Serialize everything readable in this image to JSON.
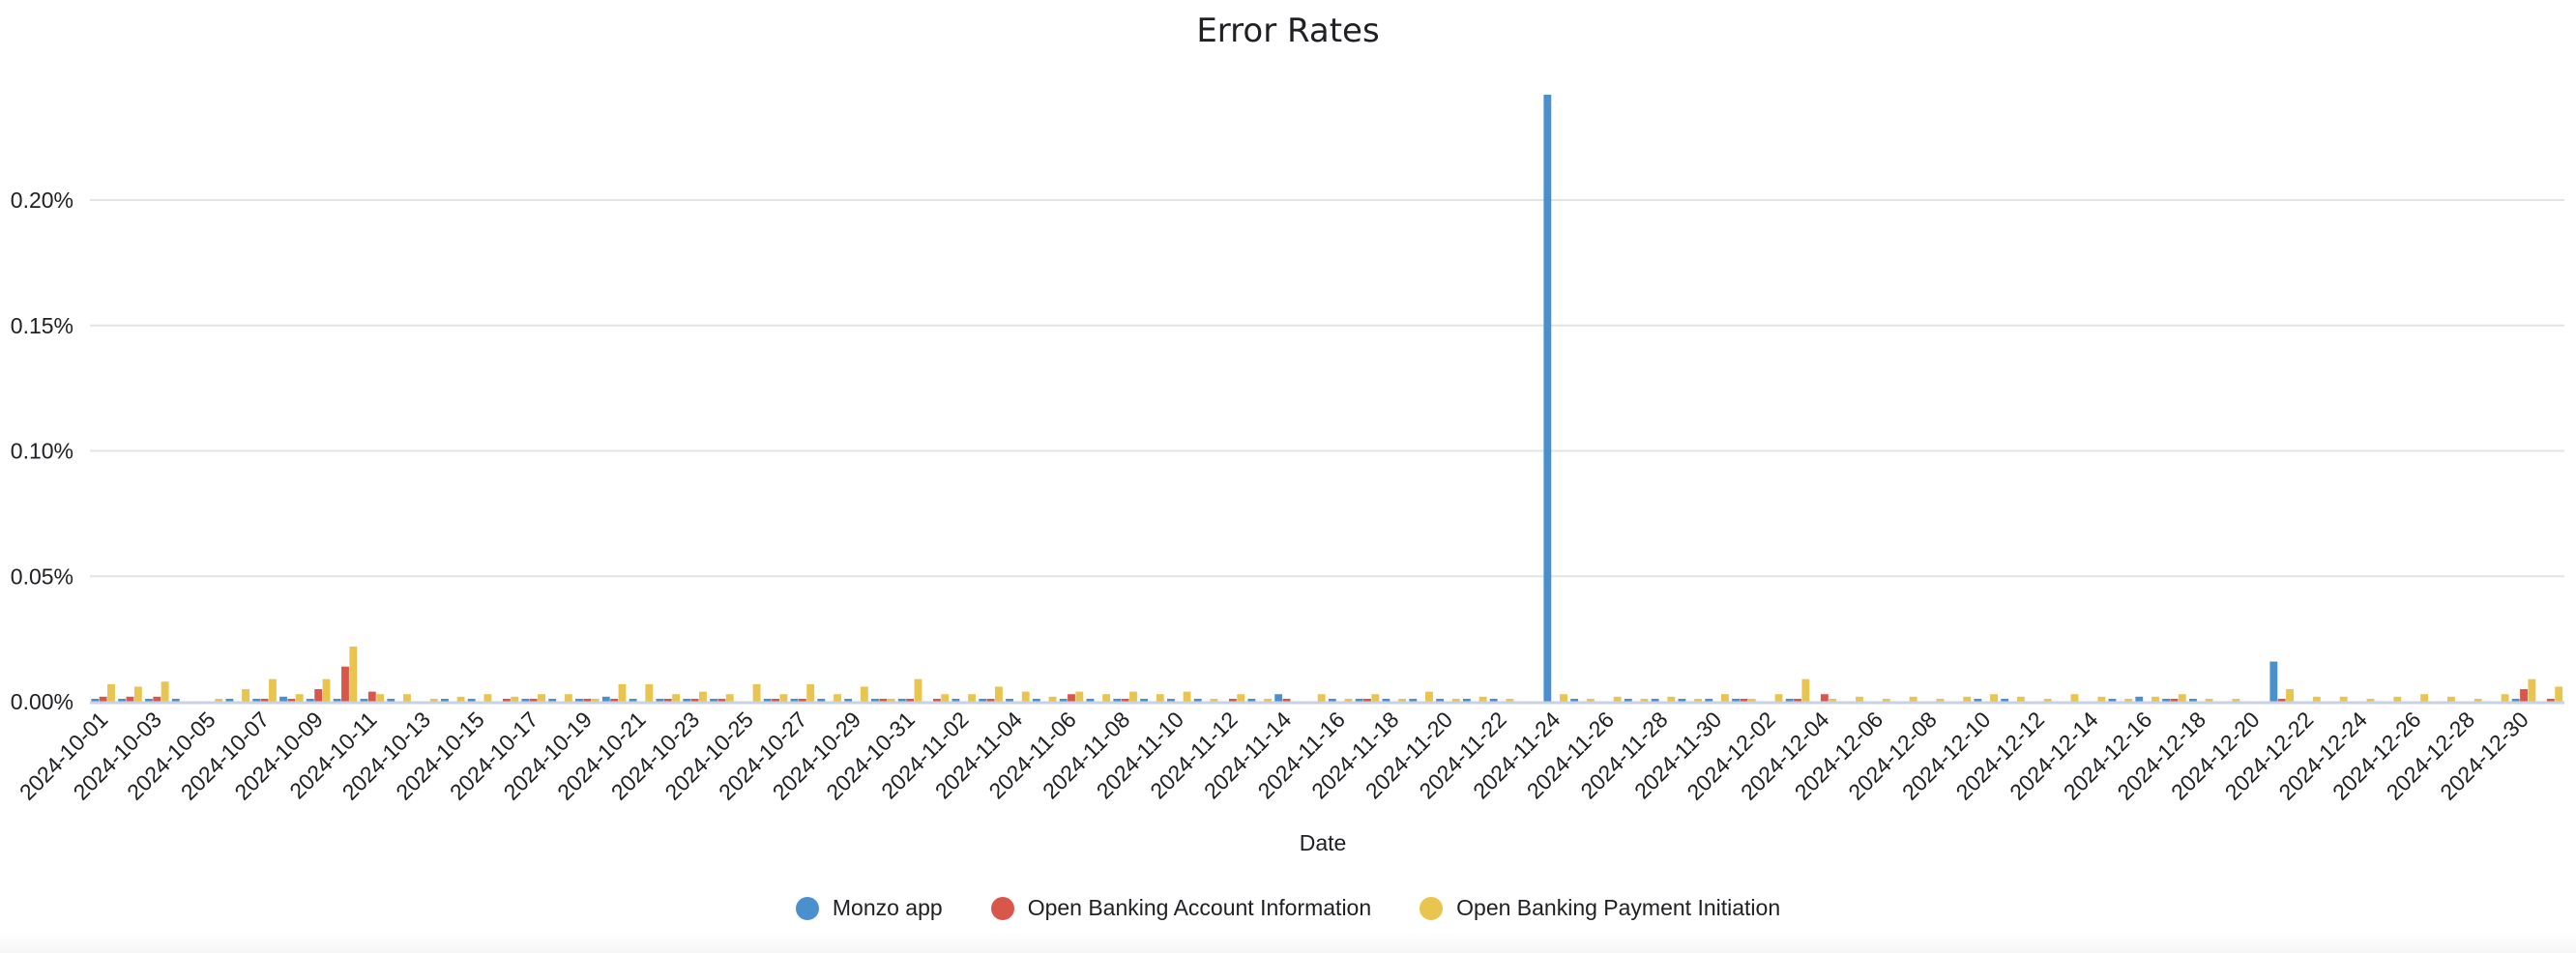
{
  "chart_data": {
    "type": "bar",
    "title": "Error Rates",
    "xlabel": "Date",
    "ylabel": "",
    "ylim": [
      0,
      0.25
    ],
    "yticks": [
      0,
      0.05,
      0.1,
      0.15,
      0.2
    ],
    "ytick_labels": [
      "0.00%",
      "0.05%",
      "0.10%",
      "0.15%",
      "0.20%"
    ],
    "grid": true,
    "legend_position": "bottom",
    "start_date": "2024-10-01",
    "end_date": "2024-12-31",
    "categories": [
      "2024-10-01",
      "2024-10-02",
      "2024-10-03",
      "2024-10-04",
      "2024-10-05",
      "2024-10-06",
      "2024-10-07",
      "2024-10-08",
      "2024-10-09",
      "2024-10-10",
      "2024-10-11",
      "2024-10-12",
      "2024-10-13",
      "2024-10-14",
      "2024-10-15",
      "2024-10-16",
      "2024-10-17",
      "2024-10-18",
      "2024-10-19",
      "2024-10-20",
      "2024-10-21",
      "2024-10-22",
      "2024-10-23",
      "2024-10-24",
      "2024-10-25",
      "2024-10-26",
      "2024-10-27",
      "2024-10-28",
      "2024-10-29",
      "2024-10-30",
      "2024-10-31",
      "2024-11-01",
      "2024-11-02",
      "2024-11-03",
      "2024-11-04",
      "2024-11-05",
      "2024-11-06",
      "2024-11-07",
      "2024-11-08",
      "2024-11-09",
      "2024-11-10",
      "2024-11-11",
      "2024-11-12",
      "2024-11-13",
      "2024-11-14",
      "2024-11-15",
      "2024-11-16",
      "2024-11-17",
      "2024-11-18",
      "2024-11-19",
      "2024-11-20",
      "2024-11-21",
      "2024-11-22",
      "2024-11-23",
      "2024-11-24",
      "2024-11-25",
      "2024-11-26",
      "2024-11-27",
      "2024-11-28",
      "2024-11-29",
      "2024-11-30",
      "2024-12-01",
      "2024-12-02",
      "2024-12-03",
      "2024-12-04",
      "2024-12-05",
      "2024-12-06",
      "2024-12-07",
      "2024-12-08",
      "2024-12-09",
      "2024-12-10",
      "2024-12-11",
      "2024-12-12",
      "2024-12-13",
      "2024-12-14",
      "2024-12-15",
      "2024-12-16",
      "2024-12-17",
      "2024-12-18",
      "2024-12-19",
      "2024-12-20",
      "2024-12-21",
      "2024-12-22",
      "2024-12-23",
      "2024-12-24",
      "2024-12-25",
      "2024-12-26",
      "2024-12-27",
      "2024-12-28",
      "2024-12-29",
      "2024-12-30",
      "2024-12-31"
    ],
    "tick_labels": [
      "2024-10-01",
      "2024-10-03",
      "2024-10-05",
      "2024-10-07",
      "2024-10-09",
      "2024-10-11",
      "2024-10-13",
      "2024-10-15",
      "2024-10-17",
      "2024-10-19",
      "2024-10-21",
      "2024-10-23",
      "2024-10-25",
      "2024-10-27",
      "2024-10-29",
      "2024-10-31",
      "2024-11-02",
      "2024-11-04",
      "2024-11-06",
      "2024-11-08",
      "2024-11-10",
      "2024-11-12",
      "2024-11-14",
      "2024-11-16",
      "2024-11-18",
      "2024-11-20",
      "2024-11-22",
      "2024-11-24",
      "2024-11-26",
      "2024-11-28",
      "2024-11-30",
      "2024-12-02",
      "2024-12-04",
      "2024-12-06",
      "2024-12-08",
      "2024-12-10",
      "2024-12-12",
      "2024-12-14",
      "2024-12-16",
      "2024-12-18",
      "2024-12-20",
      "2024-12-22",
      "2024-12-24",
      "2024-12-26",
      "2024-12-28",
      "2024-12-30"
    ],
    "series": [
      {
        "name": "Monzo app",
        "color": "#4a90cc",
        "values": [
          0.001,
          0.001,
          0.001,
          0.001,
          0,
          0.001,
          0.001,
          0.002,
          0.001,
          0.001,
          0.001,
          0.001,
          0,
          0.001,
          0.001,
          0,
          0.001,
          0.001,
          0.001,
          0.002,
          0.001,
          0.001,
          0.001,
          0.001,
          0,
          0.001,
          0.001,
          0.001,
          0.001,
          0.001,
          0.001,
          0,
          0.001,
          0.001,
          0.001,
          0.001,
          0.001,
          0.001,
          0.001,
          0.001,
          0.001,
          0.001,
          0,
          0.001,
          0.003,
          0,
          0.001,
          0.001,
          0.001,
          0.001,
          0.001,
          0.001,
          0.001,
          0,
          0.242,
          0.001,
          0,
          0.001,
          0.001,
          0.001,
          0.001,
          0.001,
          0,
          0.001,
          0,
          0,
          0,
          0,
          0,
          0,
          0.001,
          0.001,
          0,
          0,
          0,
          0.001,
          0.002,
          0.001,
          0.001,
          0,
          0,
          0.016,
          0,
          0,
          0,
          0,
          0,
          0,
          0,
          0,
          0.001,
          0
        ]
      },
      {
        "name": "Open Banking Account Information",
        "color": "#d9574a",
        "values": [
          0.002,
          0.002,
          0.002,
          0,
          0,
          0,
          0.001,
          0.001,
          0.005,
          0.014,
          0.004,
          0,
          0,
          0,
          0,
          0.001,
          0.001,
          0,
          0.001,
          0.001,
          0,
          0.001,
          0.001,
          0.001,
          0,
          0.001,
          0.001,
          0,
          0,
          0.001,
          0.001,
          0.001,
          0,
          0.001,
          0,
          0,
          0.003,
          0,
          0.001,
          0,
          0,
          0,
          0.001,
          0,
          0.001,
          0,
          0,
          0.001,
          0,
          0,
          0,
          0,
          0,
          0,
          0,
          0,
          0,
          0,
          0,
          0,
          0,
          0.001,
          0,
          0.001,
          0.003,
          0,
          0,
          0,
          0,
          0,
          0,
          0,
          0,
          0,
          0,
          0,
          0,
          0.001,
          0,
          0,
          0,
          0.001,
          0,
          0,
          0,
          0,
          0,
          0,
          0,
          0,
          0.005,
          0.001
        ]
      },
      {
        "name": "Open Banking Payment Initiation",
        "color": "#e9c44f",
        "values": [
          0.007,
          0.006,
          0.008,
          0,
          0.001,
          0.005,
          0.009,
          0.003,
          0.009,
          0.022,
          0.003,
          0.003,
          0.001,
          0.002,
          0.003,
          0.002,
          0.003,
          0.003,
          0.001,
          0.007,
          0.007,
          0.003,
          0.004,
          0.003,
          0.007,
          0.003,
          0.007,
          0.003,
          0.006,
          0.001,
          0.009,
          0.003,
          0.003,
          0.006,
          0.004,
          0.002,
          0.004,
          0.003,
          0.004,
          0.003,
          0.004,
          0.001,
          0.003,
          0.001,
          0,
          0.003,
          0.001,
          0.003,
          0.001,
          0.004,
          0.001,
          0.002,
          0.001,
          0,
          0.003,
          0.001,
          0.002,
          0.001,
          0.002,
          0.001,
          0.003,
          0.001,
          0.003,
          0.009,
          0.001,
          0.002,
          0.001,
          0.002,
          0.001,
          0.002,
          0.003,
          0.002,
          0.001,
          0.003,
          0.002,
          0.001,
          0.002,
          0.003,
          0.001,
          0.001,
          0,
          0.005,
          0.002,
          0.002,
          0.001,
          0.002,
          0.003,
          0.002,
          0.001,
          0.003,
          0.009,
          0.006
        ]
      }
    ]
  },
  "legend": {
    "items": [
      {
        "label": "Monzo app",
        "color": "#4a90cc"
      },
      {
        "label": "Open Banking Account Information",
        "color": "#d9574a"
      },
      {
        "label": "Open Banking Payment Initiation",
        "color": "#e9c44f"
      }
    ]
  }
}
